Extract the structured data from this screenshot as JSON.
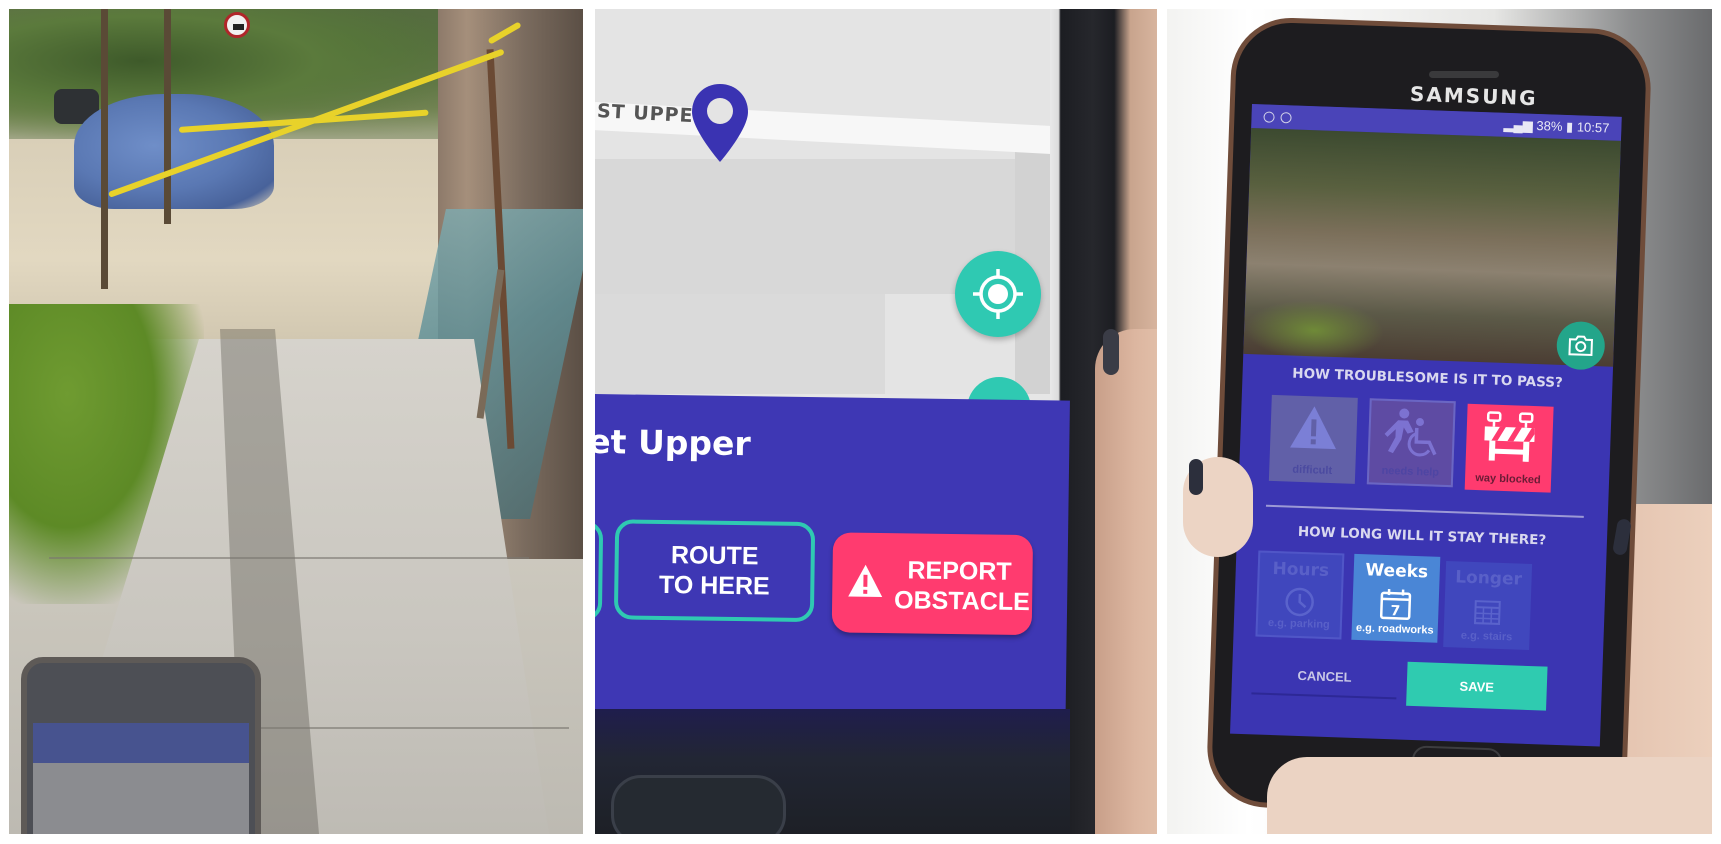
{
  "panels": {
    "left": {
      "description": "Street photo of a sidewalk blocked by construction tape"
    },
    "middle": {
      "map": {
        "street_label": "ST UPPER",
        "locate_button_icon": "crosshair-target-icon",
        "pin_icon": "map-pin-icon"
      },
      "sheet": {
        "title": "et Upper",
        "buttons": [
          {
            "label": "ROUTE\nTO HERE",
            "line1": "ROUTE",
            "line2": "TO HERE"
          },
          {
            "label": "REPORT OBSTACLE",
            "line1": "REPORT",
            "line2": "OBSTACLE",
            "icon": "warning-icon"
          }
        ]
      }
    },
    "right": {
      "device_brand": "SAMSUNG",
      "status_bar": {
        "battery": "38%",
        "time": "10:57"
      },
      "question1": "HOW TROUBLESOME IS IT TO PASS?",
      "severity_options": [
        {
          "label": "difficult",
          "icon": "warning-icon",
          "selected": false
        },
        {
          "label": "needs help",
          "icon": "assisted-wheelchair-icon",
          "selected": false
        },
        {
          "label": "way blocked",
          "icon": "road-barrier-icon",
          "selected": true
        }
      ],
      "question2": "HOW LONG WILL IT STAY THERE?",
      "duration_options": [
        {
          "title": "Hours",
          "example": "e.g. parking",
          "icon": "clock-icon",
          "selected": false
        },
        {
          "title": "Weeks",
          "example": "e.g. roadworks",
          "icon": "calendar-7-icon",
          "calendar_number": "7",
          "selected": true
        },
        {
          "title": "Longer",
          "example": "e.g. stairs",
          "icon": "calendar-grid-icon",
          "selected": false
        }
      ],
      "cancel_label": "CANCEL",
      "save_label": "SAVE"
    }
  },
  "colors": {
    "app_primary": "#3e37b4",
    "accent_teal": "#2fc9b2",
    "accent_pink": "#ff3b6f",
    "selected_blue": "#4a86d6"
  }
}
